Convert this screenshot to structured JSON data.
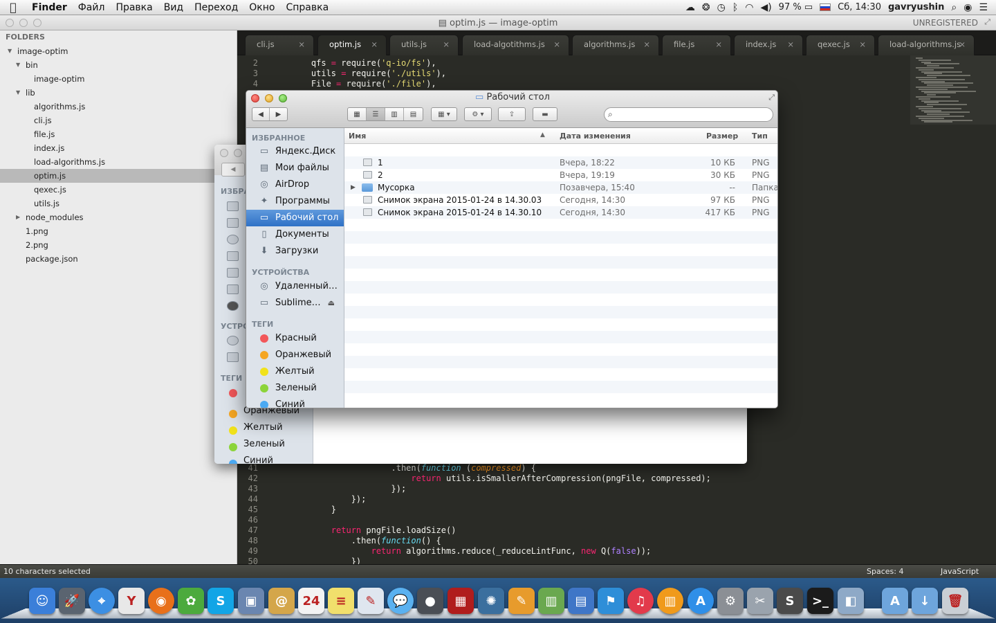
{
  "menubar": {
    "app": "Finder",
    "items": [
      "Файл",
      "Правка",
      "Вид",
      "Переход",
      "Окно",
      "Справка"
    ],
    "battery": "97 %",
    "clock": "Сб, 14:30",
    "user": "gavryushin"
  },
  "sublime": {
    "title": "optim.js — image-optim",
    "unregistered": "UNREGISTERED",
    "sidebar_header": "FOLDERS",
    "tree": [
      {
        "label": "image-optim",
        "level": 0,
        "arrow": "open"
      },
      {
        "label": "bin",
        "level": 1,
        "arrow": "open"
      },
      {
        "label": "image-optim",
        "level": 2,
        "arrow": ""
      },
      {
        "label": "lib",
        "level": 1,
        "arrow": "open"
      },
      {
        "label": "algorithms.js",
        "level": 2,
        "arrow": ""
      },
      {
        "label": "cli.js",
        "level": 2,
        "arrow": ""
      },
      {
        "label": "file.js",
        "level": 2,
        "arrow": ""
      },
      {
        "label": "index.js",
        "level": 2,
        "arrow": ""
      },
      {
        "label": "load-algorithms.js",
        "level": 2,
        "arrow": ""
      },
      {
        "label": "optim.js",
        "level": 2,
        "arrow": "",
        "selected": true
      },
      {
        "label": "qexec.js",
        "level": 2,
        "arrow": ""
      },
      {
        "label": "utils.js",
        "level": 2,
        "arrow": ""
      },
      {
        "label": "node_modules",
        "level": 1,
        "arrow": "closed"
      },
      {
        "label": "1.png",
        "level": 1,
        "arrow": ""
      },
      {
        "label": "2.png",
        "level": 1,
        "arrow": ""
      },
      {
        "label": "package.json",
        "level": 1,
        "arrow": ""
      }
    ],
    "tabs": [
      {
        "label": "cli.js"
      },
      {
        "label": "optim.js",
        "active": true
      },
      {
        "label": "utils.js"
      },
      {
        "label": "load-algotithms.js"
      },
      {
        "label": "algorithms.js"
      },
      {
        "label": "file.js"
      },
      {
        "label": "index.js"
      },
      {
        "label": "qexec.js"
      },
      {
        "label": "load-algorithms.js"
      }
    ],
    "code_top": [
      {
        "n": "2",
        "html": "    qfs <span class='kw'>=</span> require(<span class='str'>'q-io/fs'</span>),"
      },
      {
        "n": "3",
        "html": "    utils <span class='kw'>=</span> require(<span class='str'>'./utils'</span>),"
      },
      {
        "n": "4",
        "html": "    File <span class='kw'>=</span> require(<span class='str'>'./file'</span>),"
      }
    ],
    "code_bottom": [
      {
        "n": "41",
        "html": "                    .then(<span class='fn'>function</span> (<span class='arg'>compressed</span>) {"
      },
      {
        "n": "42",
        "html": "                        <span class='kw'>return</span> utils.isSmallerAfterCompression(pngFile, compressed);"
      },
      {
        "n": "43",
        "html": "                    });"
      },
      {
        "n": "44",
        "html": "            });"
      },
      {
        "n": "45",
        "html": "        }"
      },
      {
        "n": "46",
        "html": ""
      },
      {
        "n": "47",
        "html": "        <span class='kw'>return</span> pngFile.loadSize()"
      },
      {
        "n": "48",
        "html": "            .then(<span class='fn'>function</span>() {"
      },
      {
        "n": "49",
        "html": "                <span class='kw'>return</span> algorithms.reduce(_reduceLintFunc, <span class='kw'>new</span> Q(<span class='cst'>false</span>));"
      },
      {
        "n": "50",
        "html": "            })"
      }
    ],
    "status_left": "10 characters selected",
    "status_spaces": "Spaces: 4",
    "status_syntax": "JavaScript"
  },
  "backwin": {
    "sections": [
      "ИЗБРА",
      "УСТРО",
      "ТЕГИ"
    ],
    "tags": [
      {
        "label": "Оранжевый",
        "color": "#f5a623"
      },
      {
        "label": "Желтый",
        "color": "#f1e21b"
      },
      {
        "label": "Зеленый",
        "color": "#8cd43a"
      },
      {
        "label": "Синий",
        "color": "#4aa9f2"
      }
    ]
  },
  "finder": {
    "title": "Рабочий стол",
    "search_placeholder": "",
    "favorites_header": "ИЗБРАННОЕ",
    "favorites": [
      {
        "label": "Яндекс.Диск",
        "icon": "folder-icon"
      },
      {
        "label": "Мои файлы",
        "icon": "all-files-icon"
      },
      {
        "label": "AirDrop",
        "icon": "airdrop-icon"
      },
      {
        "label": "Программы",
        "icon": "applications-icon"
      },
      {
        "label": "Рабочий стол",
        "icon": "desktop-icon",
        "selected": true
      },
      {
        "label": "Документы",
        "icon": "documents-icon"
      },
      {
        "label": "Загрузки",
        "icon": "downloads-icon"
      }
    ],
    "devices_header": "УСТРОЙСТВА",
    "devices": [
      {
        "label": "Удаленный…",
        "icon": "remote-disc-icon"
      },
      {
        "label": "Sublime…",
        "icon": "disk-icon",
        "eject": true
      }
    ],
    "tags_header": "ТЕГИ",
    "tags": [
      {
        "label": "Красный",
        "color": "#f2575a"
      },
      {
        "label": "Оранжевый",
        "color": "#f5a623"
      },
      {
        "label": "Желтый",
        "color": "#f1e21b"
      },
      {
        "label": "Зеленый",
        "color": "#8cd43a"
      },
      {
        "label": "Синий",
        "color": "#4aa9f2"
      }
    ],
    "columns": {
      "name": "Имя",
      "date": "Дата изменения",
      "size": "Размер",
      "kind": "Тип"
    },
    "files": [
      {
        "name": "1",
        "date": "Вчера, 18:22",
        "size": "10 КБ",
        "kind": "PNG",
        "icon": "png-file-icon"
      },
      {
        "name": "2",
        "date": "Вчера, 19:19",
        "size": "30 КБ",
        "kind": "PNG",
        "icon": "png-file-icon"
      },
      {
        "name": "Мусорка",
        "date": "Позавчера, 15:40",
        "size": "--",
        "kind": "Папка",
        "icon": "folder-icon",
        "folder": true
      },
      {
        "name": "Снимок экрана 2015-01-24 в 14.30.03",
        "date": "Сегодня, 14:30",
        "size": "97 КБ",
        "kind": "PNG",
        "icon": "png-file-icon"
      },
      {
        "name": "Снимок экрана 2015-01-24 в 14.30.10",
        "date": "Сегодня, 14:30",
        "size": "417 КБ",
        "kind": "PNG",
        "icon": "png-file-icon"
      }
    ]
  },
  "dock": [
    {
      "name": "finder-icon",
      "color": "#3b7fd9",
      "glyph": "☺"
    },
    {
      "name": "launchpad-icon",
      "color": "#5a6470",
      "glyph": "🚀"
    },
    {
      "name": "safari-icon",
      "color": "#3c8fe3",
      "glyph": "⌖"
    },
    {
      "name": "yandex-browser-icon",
      "color": "#e8e8e8",
      "glyph": "Y"
    },
    {
      "name": "firefox-icon",
      "color": "#e8701a",
      "glyph": "◉"
    },
    {
      "name": "adium-icon",
      "color": "#4caa3d",
      "glyph": "✿"
    },
    {
      "name": "skype-icon",
      "color": "#12a5e6",
      "glyph": "S"
    },
    {
      "name": "preview-icon",
      "color": "#6a86b0",
      "glyph": "▣"
    },
    {
      "name": "contacts-icon",
      "color": "#d4a64a",
      "glyph": "@"
    },
    {
      "name": "calendar-icon",
      "color": "#f3f3f3",
      "glyph": "24"
    },
    {
      "name": "notes-icon",
      "color": "#f1df6c",
      "glyph": "≡"
    },
    {
      "name": "textedit-icon",
      "color": "#dfe6ef",
      "glyph": "✎"
    },
    {
      "name": "messages-icon",
      "color": "#5ab1f0",
      "glyph": "💬"
    },
    {
      "name": "facetime-icon",
      "color": "#4a4e55",
      "glyph": "●"
    },
    {
      "name": "photo-booth-icon",
      "color": "#b01d1d",
      "glyph": "▦"
    },
    {
      "name": "iphoto-icon",
      "color": "#3b6f9e",
      "glyph": "✺"
    },
    {
      "name": "pages-icon",
      "color": "#e79b2c",
      "glyph": "✎"
    },
    {
      "name": "numbers-icon",
      "color": "#6aa84f",
      "glyph": "▥"
    },
    {
      "name": "keynote-icon",
      "color": "#3f76c7",
      "glyph": "▤"
    },
    {
      "name": "presentation-icon",
      "color": "#2e8ed8",
      "glyph": "⚑"
    },
    {
      "name": "itunes-icon",
      "color": "#e23a4b",
      "glyph": "♫"
    },
    {
      "name": "ibooks-icon",
      "color": "#f09a1b",
      "glyph": "▥"
    },
    {
      "name": "app-store-icon",
      "color": "#2f8fe8",
      "glyph": "A"
    },
    {
      "name": "system-preferences-icon",
      "color": "#8b8f95",
      "glyph": "⚙"
    },
    {
      "name": "directory-utility-icon",
      "color": "#9aa3ad",
      "glyph": "✂"
    },
    {
      "name": "sublime-text-icon",
      "color": "#4a4a4a",
      "glyph": "S"
    },
    {
      "name": "terminal-icon",
      "color": "#1b1b1b",
      "glyph": ">_"
    },
    {
      "name": "preview-app-icon",
      "color": "#8ea9c7",
      "glyph": "◧"
    },
    {
      "name": "applications-folder-icon",
      "color": "#6ea5dc",
      "glyph": "A"
    },
    {
      "name": "downloads-folder-icon",
      "color": "#6ea5dc",
      "glyph": "↓"
    },
    {
      "name": "trash-icon",
      "color": "#c9ced4",
      "glyph": "🗑"
    }
  ]
}
